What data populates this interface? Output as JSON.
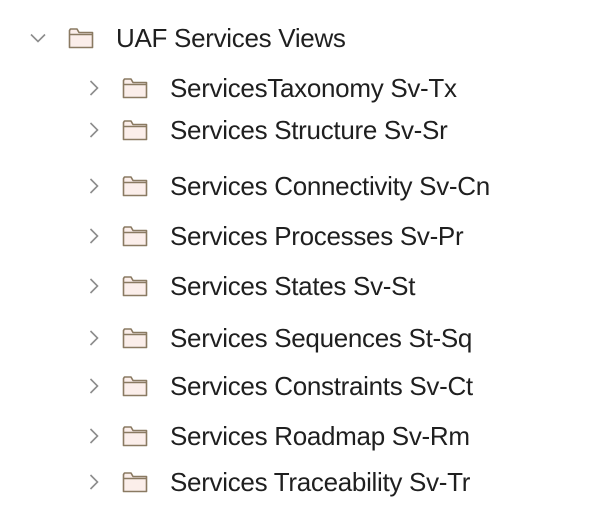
{
  "colors": {
    "folder_stroke": "#8a7a62",
    "folder_fill": "#fbeeea",
    "chevron": "#8c8c8c",
    "text": "#1f1f1f"
  },
  "icons": {
    "expanded": "chevron-down-icon",
    "collapsed": "chevron-right-icon",
    "folder": "folder-icon"
  },
  "tree": {
    "root": {
      "label": "UAF Services Views",
      "expanded": true
    },
    "children": [
      {
        "label": "ServicesTaxonomy Sv-Tx"
      },
      {
        "label": "Services Structure Sv-Sr"
      },
      {
        "label": "Services Connectivity Sv-Cn"
      },
      {
        "label": "Services Processes Sv-Pr"
      },
      {
        "label": "Services States Sv-St"
      },
      {
        "label": "Services Sequences St-Sq"
      },
      {
        "label": "Services Constraints Sv-Ct"
      },
      {
        "label": "Services Roadmap Sv-Rm"
      },
      {
        "label": "Services Traceability Sv-Tr"
      }
    ]
  }
}
